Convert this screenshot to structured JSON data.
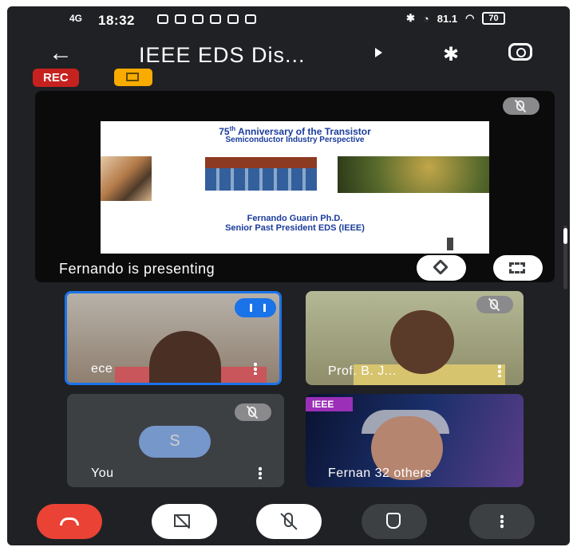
{
  "status_bar": {
    "signal": "4G",
    "time": "18:32",
    "right_text": "81.1",
    "battery": "70"
  },
  "header": {
    "title": "IEEE EDS Dis...",
    "rec_label": "REC"
  },
  "presentation": {
    "label": "Fernando is presenting",
    "slide": {
      "title_main": "Anniversary of the Transistor",
      "title_num": "75",
      "title_sup": "th",
      "subtitle": "Semiconductor Industry Perspective",
      "presenter": "Fernando Guarin Ph.D.",
      "presenter_role": "Senior Past President EDS (IEEE)"
    }
  },
  "participants": [
    {
      "name": "ece"
    },
    {
      "name": "Prof. B. J..."
    },
    {
      "name": "You",
      "avatar_letter": "S"
    },
    {
      "name": "Fernan 32 others",
      "badge": "IEEE"
    }
  ],
  "icons": {
    "back": "arrow-left-icon",
    "bluetooth": "bluetooth-icon",
    "flip": "camera-flip-icon",
    "captions": "captions-off-icon",
    "muted": "mic-off-icon",
    "pin": "pin-icon",
    "fullscreen": "fullscreen-icon",
    "end_call": "end-call-icon",
    "camera_off": "camera-off-icon",
    "raise_hand": "hand-icon",
    "more": "more-vert-icon"
  },
  "colors": {
    "rec": "#c5221f",
    "end_call": "#ea4335",
    "speaking": "#1a73e8",
    "ieee_badge": "#9b2fb8"
  }
}
